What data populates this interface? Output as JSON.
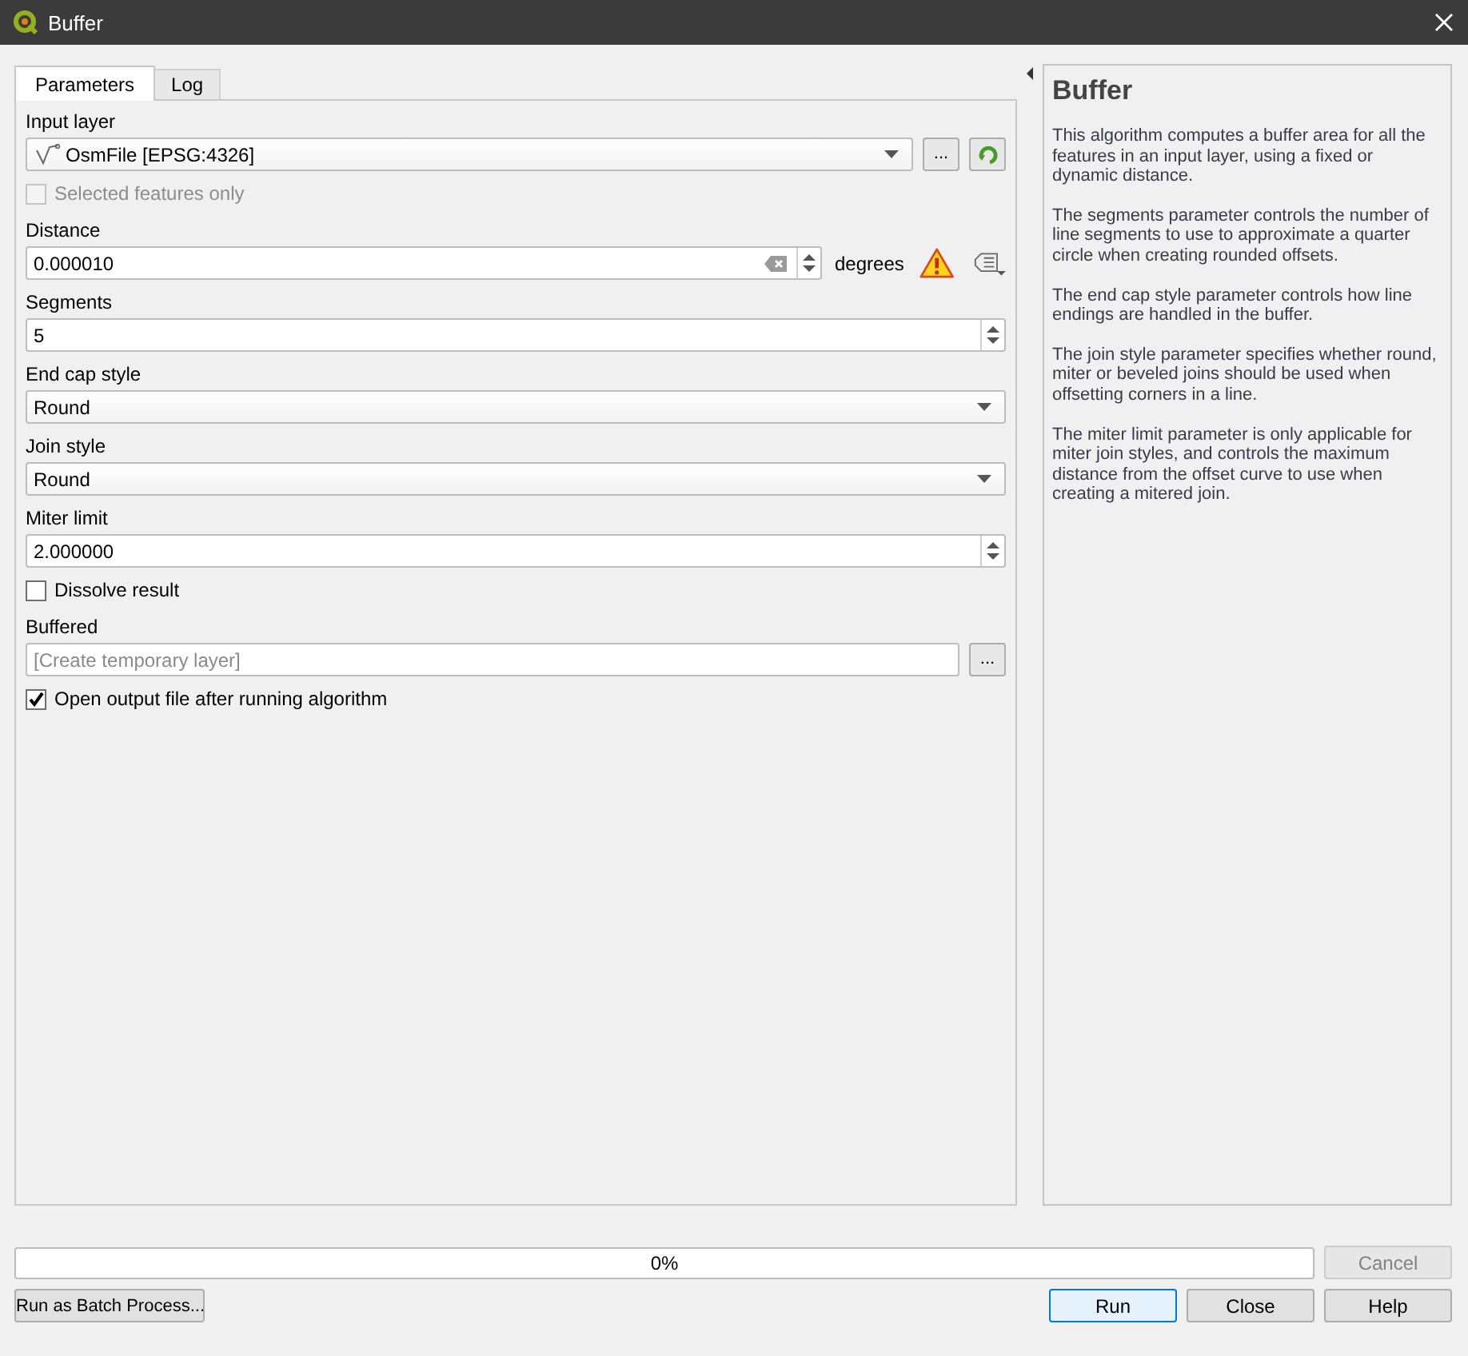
{
  "window": {
    "title": "Buffer"
  },
  "tabs": [
    {
      "label": "Parameters",
      "selected": true
    },
    {
      "label": "Log",
      "selected": false
    }
  ],
  "params": [
    {
      "kind": "layer",
      "label": "Input layer",
      "value": "OsmFile [EPSG:4326]",
      "button": "..."
    },
    {
      "kind": "checkbox",
      "label": "Selected features only",
      "checked": false,
      "disabled": true
    },
    {
      "kind": "distance",
      "label": "Distance",
      "value": "0.000010",
      "unit": "degrees",
      "warning": true
    },
    {
      "kind": "spin",
      "label": "Segments",
      "value": "5"
    },
    {
      "kind": "combo",
      "label": "End cap style",
      "value": "Round"
    },
    {
      "kind": "combo",
      "label": "Join style",
      "value": "Round"
    },
    {
      "kind": "spin",
      "label": "Miter limit",
      "value": "2.000000"
    },
    {
      "kind": "checkbox",
      "label": "Dissolve result",
      "checked": false,
      "disabled": false
    },
    {
      "kind": "output",
      "label": "Buffered",
      "placeholder": "[Create temporary layer]",
      "button": "..."
    },
    {
      "kind": "checkbox",
      "label": "Open output file after running algorithm",
      "checked": true,
      "disabled": false
    }
  ],
  "help": {
    "title": "Buffer",
    "paragraphs": [
      "This algorithm computes a buffer area for all the features in an input layer, using a fixed or dynamic distance.",
      "The segments parameter controls the number of line segments to use to approximate a quarter circle when creating rounded offsets.",
      "The end cap style parameter controls how line endings are handled in the buffer.",
      "The join style parameter specifies whether round, miter or beveled joins should be used when offsetting corners in a line.",
      "The miter limit parameter is only applicable for miter join styles, and controls the maximum distance from the offset curve to use when creating a mitered join."
    ]
  },
  "progress": {
    "level": 0,
    "reading": "0%"
  },
  "cancel_button": {
    "label": "Cancel",
    "disabled": true
  },
  "batch_button": "Run as Batch Process...",
  "buttons": [
    {
      "label": "Run",
      "default": true
    },
    {
      "label": "Close",
      "default": false
    },
    {
      "label": "Help",
      "default": false
    }
  ]
}
